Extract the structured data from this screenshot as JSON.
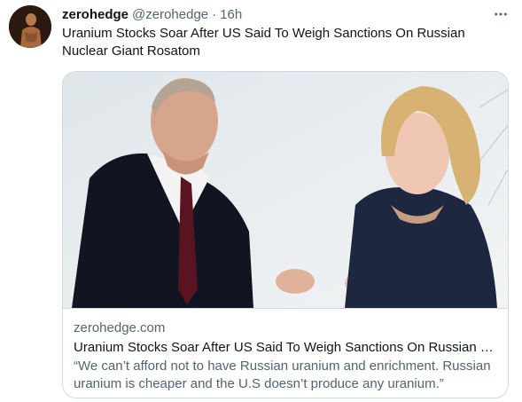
{
  "tweet": {
    "author_name": "zerohedge",
    "author_handle": "@zerohedge",
    "separator": "·",
    "time": "16h",
    "text": "Uranium Stocks Soar After US Said To Weigh Sanctions On Russian Nuclear Giant Rosatom"
  },
  "card": {
    "domain": "zerohedge.com",
    "title": "Uranium Stocks Soar After US Said To Weigh Sanctions On Russian N...",
    "description": "“We can’t afford not to have Russian uranium and enrichment. Russian uranium is cheaper and the U.S doesn’t produce any uranium.”"
  },
  "icons": {
    "avatar": "avatar-image",
    "more": "more-options-icon"
  },
  "colors": {
    "text_primary": "#0f1419",
    "text_secondary": "#536471",
    "border": "#cfd9de"
  }
}
